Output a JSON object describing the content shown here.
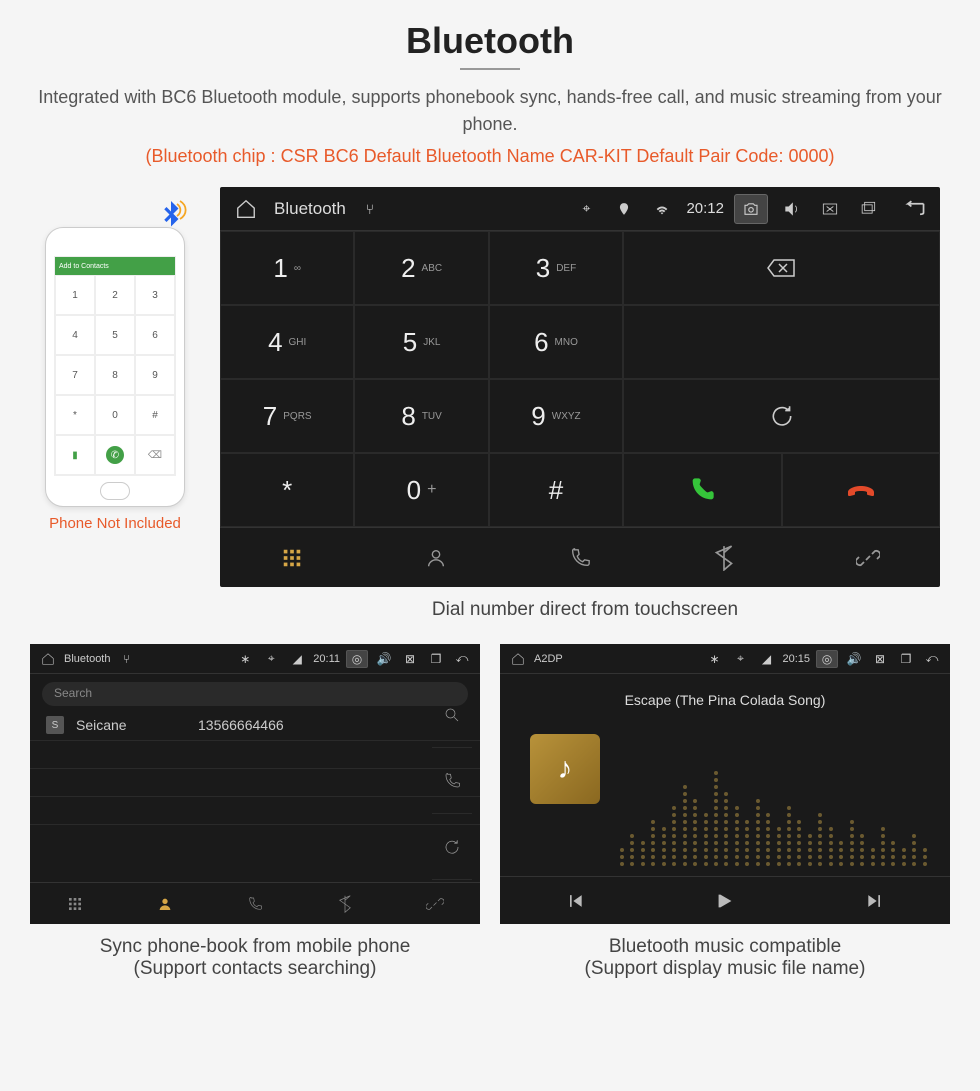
{
  "header": {
    "title": "Bluetooth",
    "description": "Integrated with BC6 Bluetooth module, supports phonebook sync, hands-free call, and music streaming from your phone.",
    "specs": "(Bluetooth chip : CSR BC6    Default Bluetooth Name CAR-KIT    Default Pair Code: 0000)"
  },
  "phone": {
    "top_label": "Add to Contacts",
    "caption": "Phone Not Included",
    "keys": [
      "1",
      "2",
      "3",
      "4",
      "5",
      "6",
      "7",
      "8",
      "9",
      "*",
      "0",
      "#"
    ]
  },
  "dialer": {
    "status": {
      "title": "Bluetooth",
      "time": "20:12"
    },
    "keys": [
      {
        "num": "1",
        "let": "∞"
      },
      {
        "num": "2",
        "let": "ABC"
      },
      {
        "num": "3",
        "let": "DEF"
      },
      {
        "num": "4",
        "let": "GHI"
      },
      {
        "num": "5",
        "let": "JKL"
      },
      {
        "num": "6",
        "let": "MNO"
      },
      {
        "num": "7",
        "let": "PQRS"
      },
      {
        "num": "8",
        "let": "TUV"
      },
      {
        "num": "9",
        "let": "WXYZ"
      },
      {
        "num": "*",
        "let": ""
      },
      {
        "num": "0",
        "let": "+"
      },
      {
        "num": "#",
        "let": ""
      }
    ],
    "caption": "Dial number direct from touchscreen"
  },
  "phonebook": {
    "status": {
      "title": "Bluetooth",
      "time": "20:11"
    },
    "search_placeholder": "Search",
    "contact": {
      "badge": "S",
      "name": "Seicane",
      "number": "13566664466"
    },
    "caption_line1": "Sync phone-book from mobile phone",
    "caption_line2": "(Support contacts searching)"
  },
  "music": {
    "status": {
      "title": "A2DP",
      "time": "20:15"
    },
    "song": "Escape (The Pina Colada Song)",
    "caption_line1": "Bluetooth music compatible",
    "caption_line2": "(Support display music file name)"
  },
  "icons": {
    "home": "home",
    "usb": "usb",
    "bt": "bluetooth",
    "loc": "location",
    "wifi": "wifi",
    "cam": "camera",
    "vol": "volume",
    "close": "close",
    "recent": "recent",
    "back": "back",
    "backspace": "backspace",
    "redial": "redial",
    "call": "call",
    "hangup": "hangup",
    "keypad_tab": "keypad",
    "contacts_tab": "contacts",
    "recents_tab": "recents",
    "bt_tab": "bluetooth",
    "link_tab": "link",
    "search": "search",
    "phone": "phone",
    "refresh": "refresh",
    "music_note": "music",
    "prev": "prev",
    "play": "play",
    "next": "next"
  }
}
